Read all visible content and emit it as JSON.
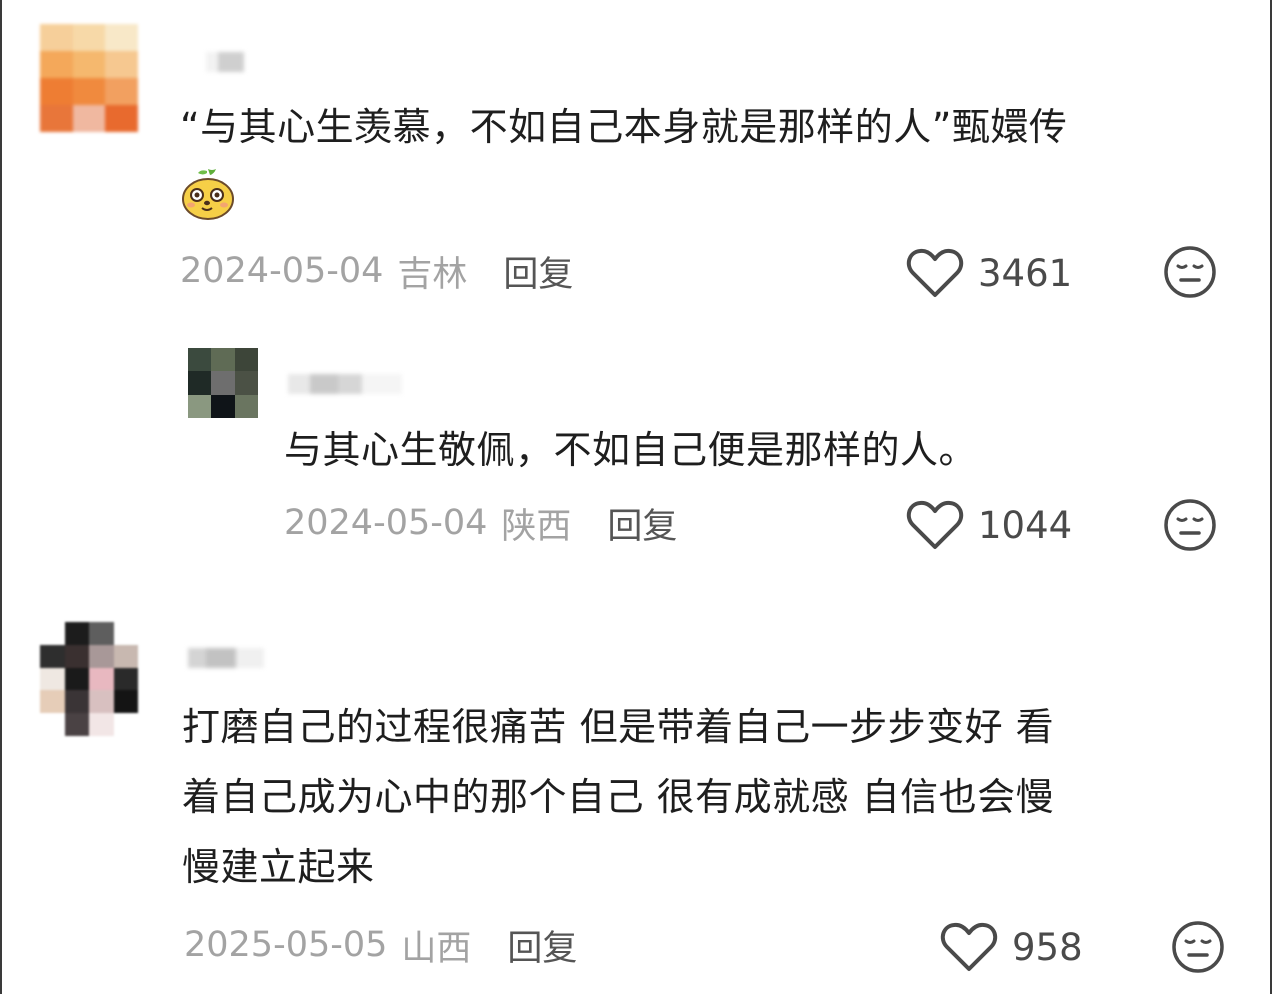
{
  "comments": [
    {
      "text_lines": [
        "“与其心生羡慕，不如自己本身就是那样的人”甄嬛传"
      ],
      "has_emoji": true,
      "emoji_icon": "cute-mascot-emoji-icon",
      "date": "2024-05-04",
      "region": "吉林",
      "reply_label": "回复",
      "likes": "3461",
      "avatar_colors": [
        "#f6cf9a",
        "#f7d9a8",
        "#f8e8c8",
        "#f4a85a",
        "#f5b86e",
        "#f6c890",
        "#ee7d33",
        "#f08a3e",
        "#f2a060",
        "#e8763a",
        "#f0b8a0",
        "#e86a2e"
      ]
    },
    {
      "text_lines": [
        "与其心生敬佩，不如自己便是那样的人。"
      ],
      "has_emoji": false,
      "date": "2024-05-04",
      "region": "陕西",
      "reply_label": "回复",
      "likes": "1044",
      "avatar_colors": [
        "#3b4a3e",
        "#5f6b55",
        "#3d4539",
        "#1f2a26",
        "#6e6e6e",
        "#4b5145",
        "#8a9880",
        "#0f1418",
        "#6a7560"
      ]
    },
    {
      "text_lines": [
        "打磨自己的过程很痛苦 但是带着自己一步步变好 看",
        "着自己成为心中的那个自己 很有成就感 自信也会慢",
        "慢建立起来"
      ],
      "has_emoji": false,
      "date": "2025-05-05",
      "region": "山西",
      "reply_label": "回复",
      "likes": "958",
      "avatar_colors": [
        "#ffffff",
        "#1c1c1c",
        "#5e5e5e",
        "#ffffff",
        "#2e2e2e",
        "#3a3030",
        "#a89898",
        "#c8b8b0",
        "#efe8e2",
        "#1a1a1a",
        "#e8b8c0",
        "#2a2a2a",
        "#e6cdb8",
        "#3a3436",
        "#d8c0c0",
        "#141414",
        "#ffffff",
        "#4a4244",
        "#f2e6e6",
        "#ffffff"
      ]
    }
  ],
  "icons": {
    "like": "heart-outline-icon",
    "dislike": "neutral-face-icon"
  },
  "colors": {
    "text": "#1e1e1e",
    "meta": "#a3a3a3",
    "reply": "#555555",
    "like": "#4a4a4a"
  }
}
